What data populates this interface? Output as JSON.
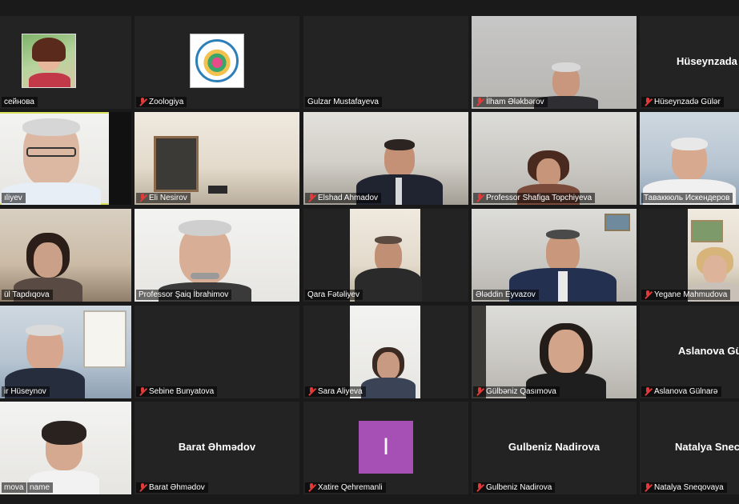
{
  "meeting": {
    "participants": [
      {
        "name": "сейнова",
        "muted": false,
        "type": "photo"
      },
      {
        "name": "Zoologiya",
        "muted": true,
        "type": "logo"
      },
      {
        "name": "Gulzar Mustafayeva",
        "muted": false,
        "type": "blank"
      },
      {
        "name": "İlham Ələkbərov",
        "muted": true,
        "type": "video"
      },
      {
        "name": "Hüseynzadə Gülər",
        "muted": true,
        "type": "name",
        "display": "Hüseynzada"
      },
      {
        "name": "ıliyev",
        "muted": false,
        "type": "video",
        "active": true
      },
      {
        "name": "Eli Nesirov",
        "muted": true,
        "type": "video"
      },
      {
        "name": "Elshad Ahmadov",
        "muted": true,
        "type": "video"
      },
      {
        "name": "Professor Shafiga Topchiyeva",
        "muted": true,
        "type": "video"
      },
      {
        "name": "Таваккюль Искендеров",
        "muted": false,
        "type": "video"
      },
      {
        "name": "ül Tapdıqova",
        "muted": false,
        "type": "video"
      },
      {
        "name": "Professor Şaiq İbrahimov",
        "muted": false,
        "type": "video"
      },
      {
        "name": "Qara Fətəliyev",
        "muted": false,
        "type": "video"
      },
      {
        "name": "Ələddin Eyvazov",
        "muted": false,
        "type": "video"
      },
      {
        "name": "Yegane Mahmudova",
        "muted": true,
        "type": "video"
      },
      {
        "name": "ir Hüseynov",
        "muted": false,
        "type": "video"
      },
      {
        "name": "Sebine Bunyatova",
        "muted": true,
        "type": "blank"
      },
      {
        "name": "Sara Aliyeva",
        "muted": true,
        "type": "video"
      },
      {
        "name": "Gülbəniz Qasımova",
        "muted": true,
        "type": "video"
      },
      {
        "name": "Aslanova Gülnarə",
        "muted": true,
        "type": "name",
        "display": "Aslanova Gü"
      },
      {
        "name": "mova",
        "muted": false,
        "type": "video",
        "extra": "name"
      },
      {
        "name": "Barat Əhmədov",
        "muted": true,
        "type": "name",
        "display": "Barat Əhmədov"
      },
      {
        "name": "Xatire Qehremanli",
        "muted": true,
        "type": "avatar",
        "letter": "I"
      },
      {
        "name": "Gulbeniz Nadirova",
        "muted": true,
        "type": "name",
        "display": "Gulbeniz Nadirova"
      },
      {
        "name": "Natalya Sneqovaya",
        "muted": true,
        "type": "name",
        "display": "Natalya Snec"
      }
    ]
  },
  "colors": {
    "background": "#1a1a1a",
    "tile": "#232323",
    "active_border": "#d9e05a",
    "muted_icon": "#e03a3a",
    "avatar_bg": "#a64fb4"
  },
  "icons": {
    "muted": "mic-off-icon"
  }
}
